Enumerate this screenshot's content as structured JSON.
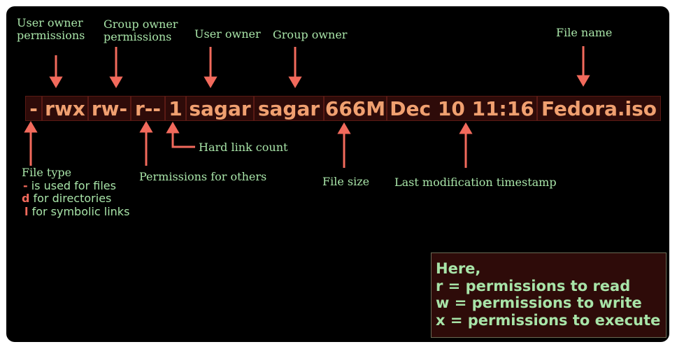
{
  "segments": [
    {
      "text": "-"
    },
    {
      "text": "rwx"
    },
    {
      "text": "rw-"
    },
    {
      "text": "r--"
    },
    {
      "text": "1"
    },
    {
      "text": "sagar"
    },
    {
      "text": "sagar"
    },
    {
      "text": "666M"
    },
    {
      "text": "Dec 10 11:16"
    },
    {
      "text": "Fedora.iso"
    }
  ],
  "labels": {
    "user_owner_permissions": [
      "User owner",
      "permissions"
    ],
    "group_owner_permissions": [
      "Group owner",
      "permissions"
    ],
    "user_owner": "User owner",
    "group_owner": "Group owner",
    "file_name": "File name",
    "hard_link_count": "Hard link count",
    "file_type": {
      "title": "File type",
      "lines": [
        {
          "symbol": "-",
          "text": "is used for files"
        },
        {
          "symbol": "d",
          "text": "for directories"
        },
        {
          "symbol": "l",
          "text": "for symbolic links"
        }
      ]
    },
    "permissions_for_others": "Permissions for others",
    "file_size": "File size",
    "last_modification": "Last modification timestamp"
  },
  "note": {
    "lines": [
      "Here,",
      "r = permissions to read",
      "w = permissions to write",
      "x = permissions to execute"
    ]
  },
  "colors": {
    "background": "#000000",
    "label_text": "#a8e4a8",
    "arrow": "#f26a5c",
    "segment_text": "#f0a070",
    "segment_bg": "#2e0b09"
  }
}
